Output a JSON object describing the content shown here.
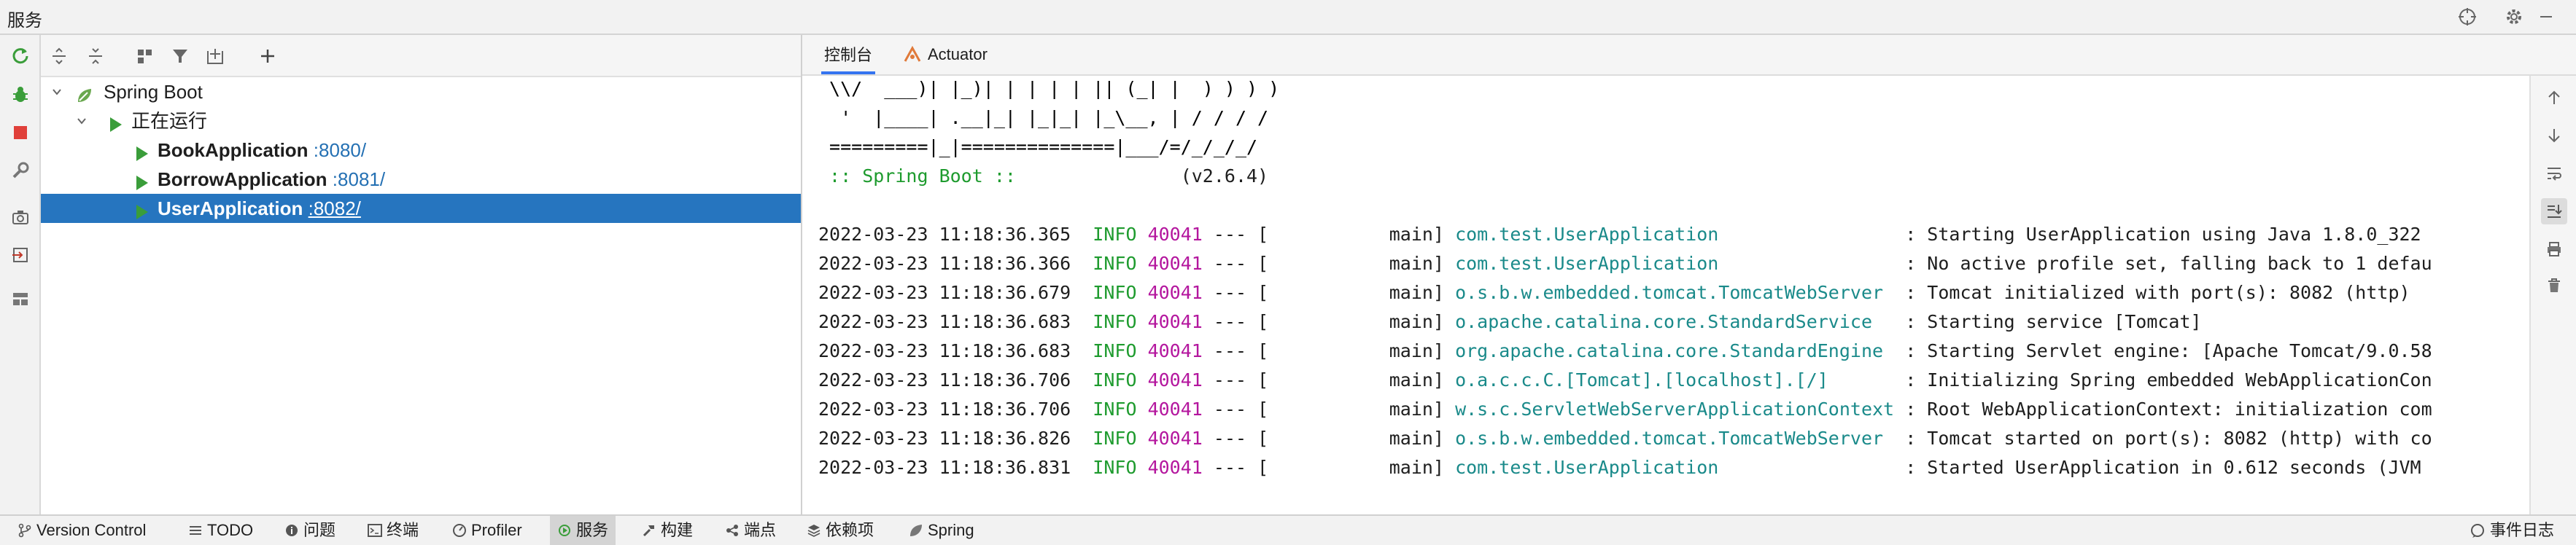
{
  "titlebar": {
    "title": "服务"
  },
  "tree": {
    "root": {
      "label": "Spring Boot"
    },
    "group": {
      "label": "正在运行"
    },
    "apps": [
      {
        "name": "BookApplication",
        "port": ":8080/"
      },
      {
        "name": "BorrowApplication",
        "port": ":8081/"
      },
      {
        "name": "UserApplication",
        "port": ":8082/"
      }
    ]
  },
  "tabs": [
    {
      "label": "控制台",
      "active": true
    },
    {
      "label": "Actuator",
      "active": false
    }
  ],
  "console": {
    "banner": [
      " \\\\/  ___)| |_)| | | | | || (_| |  ) ) ) )",
      "  '  |____| .__|_| |_|_| |_\\__, | / / / /",
      " =========|_|==============|___/=/_/_/_/"
    ],
    "spring_label": " :: Spring Boot :: ",
    "spring_version": "              (v2.6.4)",
    "logs": [
      {
        "ts": "2022-03-23 11:18:36.365",
        "level": "INFO",
        "pid": "40041",
        "sep": "--- [",
        "thread": "           main]",
        "logger": "com.test.UserApplication                ",
        "msg": ": Starting UserApplication using Java 1.8.0_322"
      },
      {
        "ts": "2022-03-23 11:18:36.366",
        "level": "INFO",
        "pid": "40041",
        "sep": "--- [",
        "thread": "           main]",
        "logger": "com.test.UserApplication                ",
        "msg": ": No active profile set, falling back to 1 defau"
      },
      {
        "ts": "2022-03-23 11:18:36.679",
        "level": "INFO",
        "pid": "40041",
        "sep": "--- [",
        "thread": "           main]",
        "logger": "o.s.b.w.embedded.tomcat.TomcatWebServer ",
        "msg": ": Tomcat initialized with port(s): 8082 (http)"
      },
      {
        "ts": "2022-03-23 11:18:36.683",
        "level": "INFO",
        "pid": "40041",
        "sep": "--- [",
        "thread": "           main]",
        "logger": "o.apache.catalina.core.StandardService  ",
        "msg": ": Starting service [Tomcat]"
      },
      {
        "ts": "2022-03-23 11:18:36.683",
        "level": "INFO",
        "pid": "40041",
        "sep": "--- [",
        "thread": "           main]",
        "logger": "org.apache.catalina.core.StandardEngine ",
        "msg": ": Starting Servlet engine: [Apache Tomcat/9.0.58"
      },
      {
        "ts": "2022-03-23 11:18:36.706",
        "level": "INFO",
        "pid": "40041",
        "sep": "--- [",
        "thread": "           main]",
        "logger": "o.a.c.c.C.[Tomcat].[localhost].[/]      ",
        "msg": ": Initializing Spring embedded WebApplicationCon"
      },
      {
        "ts": "2022-03-23 11:18:36.706",
        "level": "INFO",
        "pid": "40041",
        "sep": "--- [",
        "thread": "           main]",
        "logger": "w.s.c.ServletWebServerApplicationContext",
        "msg": ": Root WebApplicationContext: initialization com"
      },
      {
        "ts": "2022-03-23 11:18:36.826",
        "level": "INFO",
        "pid": "40041",
        "sep": "--- [",
        "thread": "           main]",
        "logger": "o.s.b.w.embedded.tomcat.TomcatWebServer ",
        "msg": ": Tomcat started on port(s): 8082 (http) with co"
      },
      {
        "ts": "2022-03-23 11:18:36.831",
        "level": "INFO",
        "pid": "40041",
        "sep": "--- [",
        "thread": "           main]",
        "logger": "com.test.UserApplication                ",
        "msg": ": Started UserApplication in 0.612 seconds (JVM"
      }
    ]
  },
  "statusbar": {
    "items": [
      {
        "label": "Version Control",
        "icon": "branch-icon"
      },
      {
        "label": "TODO",
        "icon": "list-icon"
      },
      {
        "label": "问题",
        "icon": "info-icon"
      },
      {
        "label": "终端",
        "icon": "terminal-icon"
      },
      {
        "label": "Profiler",
        "icon": "profiler-icon"
      },
      {
        "label": "服务",
        "icon": "services-icon",
        "active": true
      },
      {
        "label": "构建",
        "icon": "hammer-icon"
      },
      {
        "label": "端点",
        "icon": "endpoints-icon"
      },
      {
        "label": "依赖项",
        "icon": "layers-icon"
      },
      {
        "label": "Spring",
        "icon": "spring-leaf-icon"
      }
    ],
    "event_log": "事件日志"
  },
  "colors": {
    "selection": "#2675bf",
    "info": "#1e9b2e",
    "pid": "#b4169e",
    "logger": "#1a8a8a",
    "run_green": "#3a9d3a"
  }
}
